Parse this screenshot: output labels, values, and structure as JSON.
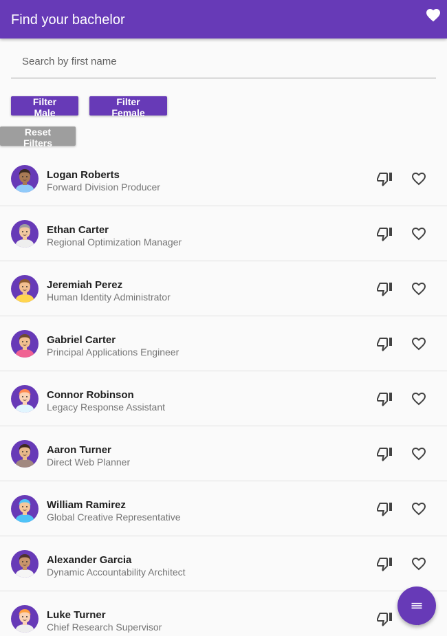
{
  "app": {
    "title": "Find your bachelor",
    "accent": "#673ab7"
  },
  "search": {
    "placeholder": "Search by first name",
    "value": ""
  },
  "filters": {
    "male": "Filter Male",
    "female": "Filter Female",
    "reset": "Reset Filters"
  },
  "icons": {
    "favorites": "heart-filled-icon",
    "dislike": "thumb-down-icon",
    "like": "heart-outline-icon",
    "menu": "menu-icon"
  },
  "people": [
    {
      "name": "Logan Roberts",
      "job": "Forward Division Producer",
      "skin": "#a87a55",
      "hair": "#3a2a20",
      "shirt": "#90caf9"
    },
    {
      "name": "Ethan Carter",
      "job": "Regional Optimization Manager",
      "skin": "#f2c9a0",
      "hair": "#9e9e9e",
      "shirt": "#eeeeee"
    },
    {
      "name": "Jeremiah Perez",
      "job": "Human Identity Administrator",
      "skin": "#f2c090",
      "hair": "#8d5b2e",
      "shirt": "#ffd54f"
    },
    {
      "name": "Gabriel Carter",
      "job": "Principal Applications Engineer",
      "skin": "#f2c090",
      "hair": "#6d4c30",
      "shirt": "#f06292"
    },
    {
      "name": "Connor Robinson",
      "job": "Legacy Response Assistant",
      "skin": "#fbd3b5",
      "hair": "#ff8a50",
      "shirt": "#e1f5fe"
    },
    {
      "name": "Aaron Turner",
      "job": "Direct Web Planner",
      "skin": "#e8b88a",
      "hair": "#3e2a20",
      "shirt": "#a1887f"
    },
    {
      "name": "William Ramirez",
      "job": "Global Creative Representative",
      "skin": "#f5c89a",
      "hair": "#4fc3f7",
      "shirt": "#4fc3f7"
    },
    {
      "name": "Alexander Garcia",
      "job": "Dynamic Accountability Architect",
      "skin": "#c9956b",
      "hair": "#4e342e",
      "shirt": "#f5f5f5"
    },
    {
      "name": "Luke Turner",
      "job": "Chief Research Supervisor",
      "skin": "#fbd3b5",
      "hair": "#ffa040",
      "shirt": "#eeeeee"
    }
  ]
}
